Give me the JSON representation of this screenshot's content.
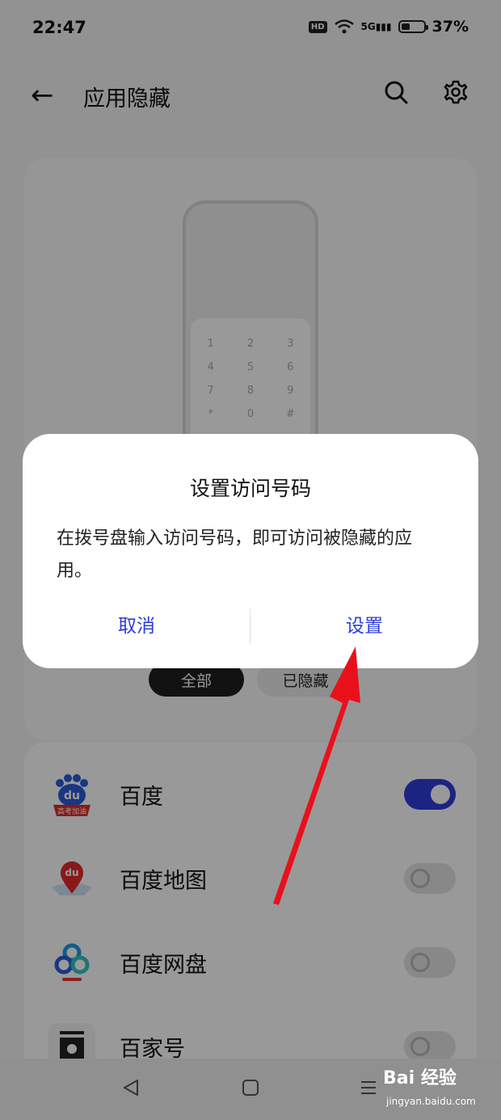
{
  "status_bar": {
    "time": "22:47",
    "hd": "HD",
    "signal_label": "5G",
    "battery": "37%",
    "battery_level": 0.37
  },
  "header": {
    "title": "应用隐藏"
  },
  "illustration": {
    "keypad": [
      "1",
      "2",
      "3",
      "4",
      "5",
      "6",
      "7",
      "8",
      "9",
      "*",
      "0",
      "#"
    ],
    "filters": {
      "all": "全部",
      "hidden": "已隐藏"
    }
  },
  "apps": [
    {
      "name": "百度",
      "icon": "baidu-app-icon",
      "icon_text": "du",
      "badge": "高考加油",
      "hidden": true
    },
    {
      "name": "百度地图",
      "icon": "baidu-map-icon",
      "icon_text": "du",
      "hidden": false
    },
    {
      "name": "百度网盘",
      "icon": "baidu-netdisk-icon",
      "hidden": false
    },
    {
      "name": "百家号",
      "icon": "baijiahao-icon",
      "hidden": false
    }
  ],
  "dialog": {
    "title": "设置访问号码",
    "message": "在拨号盘输入访问号码，即可访问被隐藏的应用。",
    "cancel_label": "取消",
    "confirm_label": "设置"
  },
  "watermark": {
    "brand": "Bai 经验",
    "url": "jingyan.baidu.com"
  },
  "colors": {
    "accent": "#2d3ed8",
    "arrow": "#e8111b",
    "toggle_on": "#2d3ed8"
  }
}
